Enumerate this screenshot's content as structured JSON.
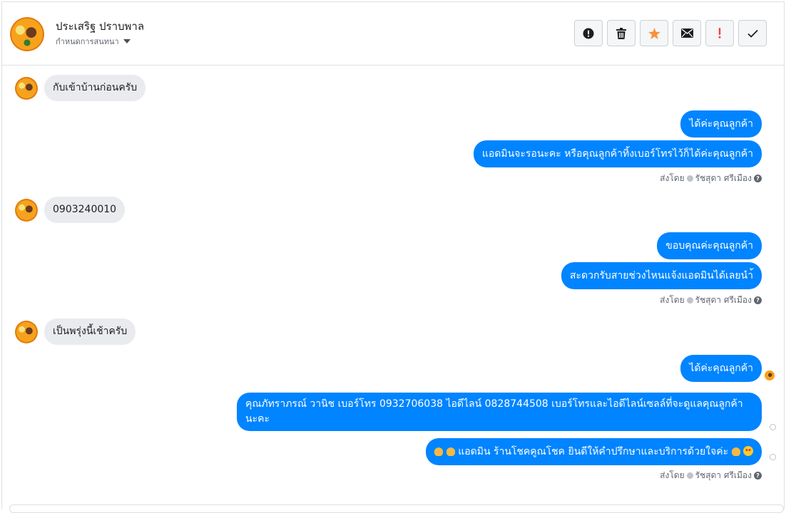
{
  "header": {
    "contact_name": "ประเสริฐ ปราบพาล",
    "conversation_select": "กำหนดการสนทนา",
    "actions": [
      {
        "name": "mark-spam",
        "icon": "exclamation-circle-icon"
      },
      {
        "name": "delete",
        "icon": "trash-icon"
      },
      {
        "name": "star",
        "icon": "star-icon",
        "color": "#f7923a"
      },
      {
        "name": "mark-unread",
        "icon": "envelope-icon"
      },
      {
        "name": "follow-up",
        "icon": "exclamation-icon",
        "color": "#fa3e3e"
      },
      {
        "name": "mark-done",
        "icon": "checkmark-icon"
      }
    ]
  },
  "messages": {
    "in_1": "กับเข้าบ้านก่อนครับ",
    "out_1a": "ได้ค่ะคุณลูกค้า",
    "out_1b": "แอดมินจะรอนะคะ  หรือคุณลูกค้าทิ้งเบอร์โทรไว้ก็ได้ค่ะคุณลูกค้า",
    "in_2": "0903240010",
    "out_2a": "ขอบคุณค่ะคุณลูกค้า",
    "out_2b": "สะดวกรับสายช่วงไหนแจ้งแอดมินได้เลยนำ้",
    "in_3": "เป็นพรุ่งนี้เช้าครับ",
    "out_3a": "ได้ค่ะคุณลูกค้า",
    "out_3b": "คุณภัทราภรณ์  วานิช      เบอร์โทร 0932706038  ไอดีไลน์ 0828744508   เบอร์โทรและไอดีไลน์เซลล์ที่จะดูแลคุณลูกค้านะคะ",
    "out_3c": "แอดมิน ร้านโชคคูณโชค ยินดีให้คำปรึกษาและบริการด้วยใจค่ะ"
  },
  "sent_by": {
    "label": "ส่งโดย",
    "agent": "รัชสุดา ศรีเมือง"
  },
  "colors": {
    "outgoing_bubble": "#0084ff",
    "incoming_bubble": "#e9ebee"
  }
}
